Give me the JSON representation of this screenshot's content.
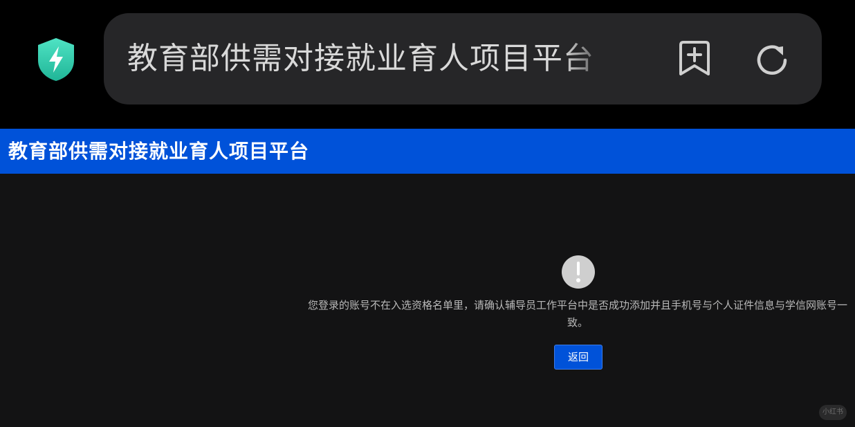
{
  "browser": {
    "address_title": "教育部供需对接就业育人项目平台",
    "security_icon": "shield-lightning-icon",
    "bookmark_icon": "bookmark-add-icon",
    "reload_icon": "reload-icon",
    "colors": {
      "shield_gradient_top": "#4fe3c4",
      "shield_gradient_bottom": "#20b597",
      "pill_background": "#262628"
    }
  },
  "header": {
    "title": "教育部供需对接就业育人项目平台",
    "background": "#0052d9"
  },
  "main": {
    "alert_icon": "exclamation-circle-icon",
    "message": "您登录的账号不在入选资格名单里，请确认辅导员工作平台中是否成功添加并且手机号与个人证件信息与学信网账号一致。",
    "back_button_label": "返回"
  },
  "watermark": {
    "text": "小红书"
  }
}
